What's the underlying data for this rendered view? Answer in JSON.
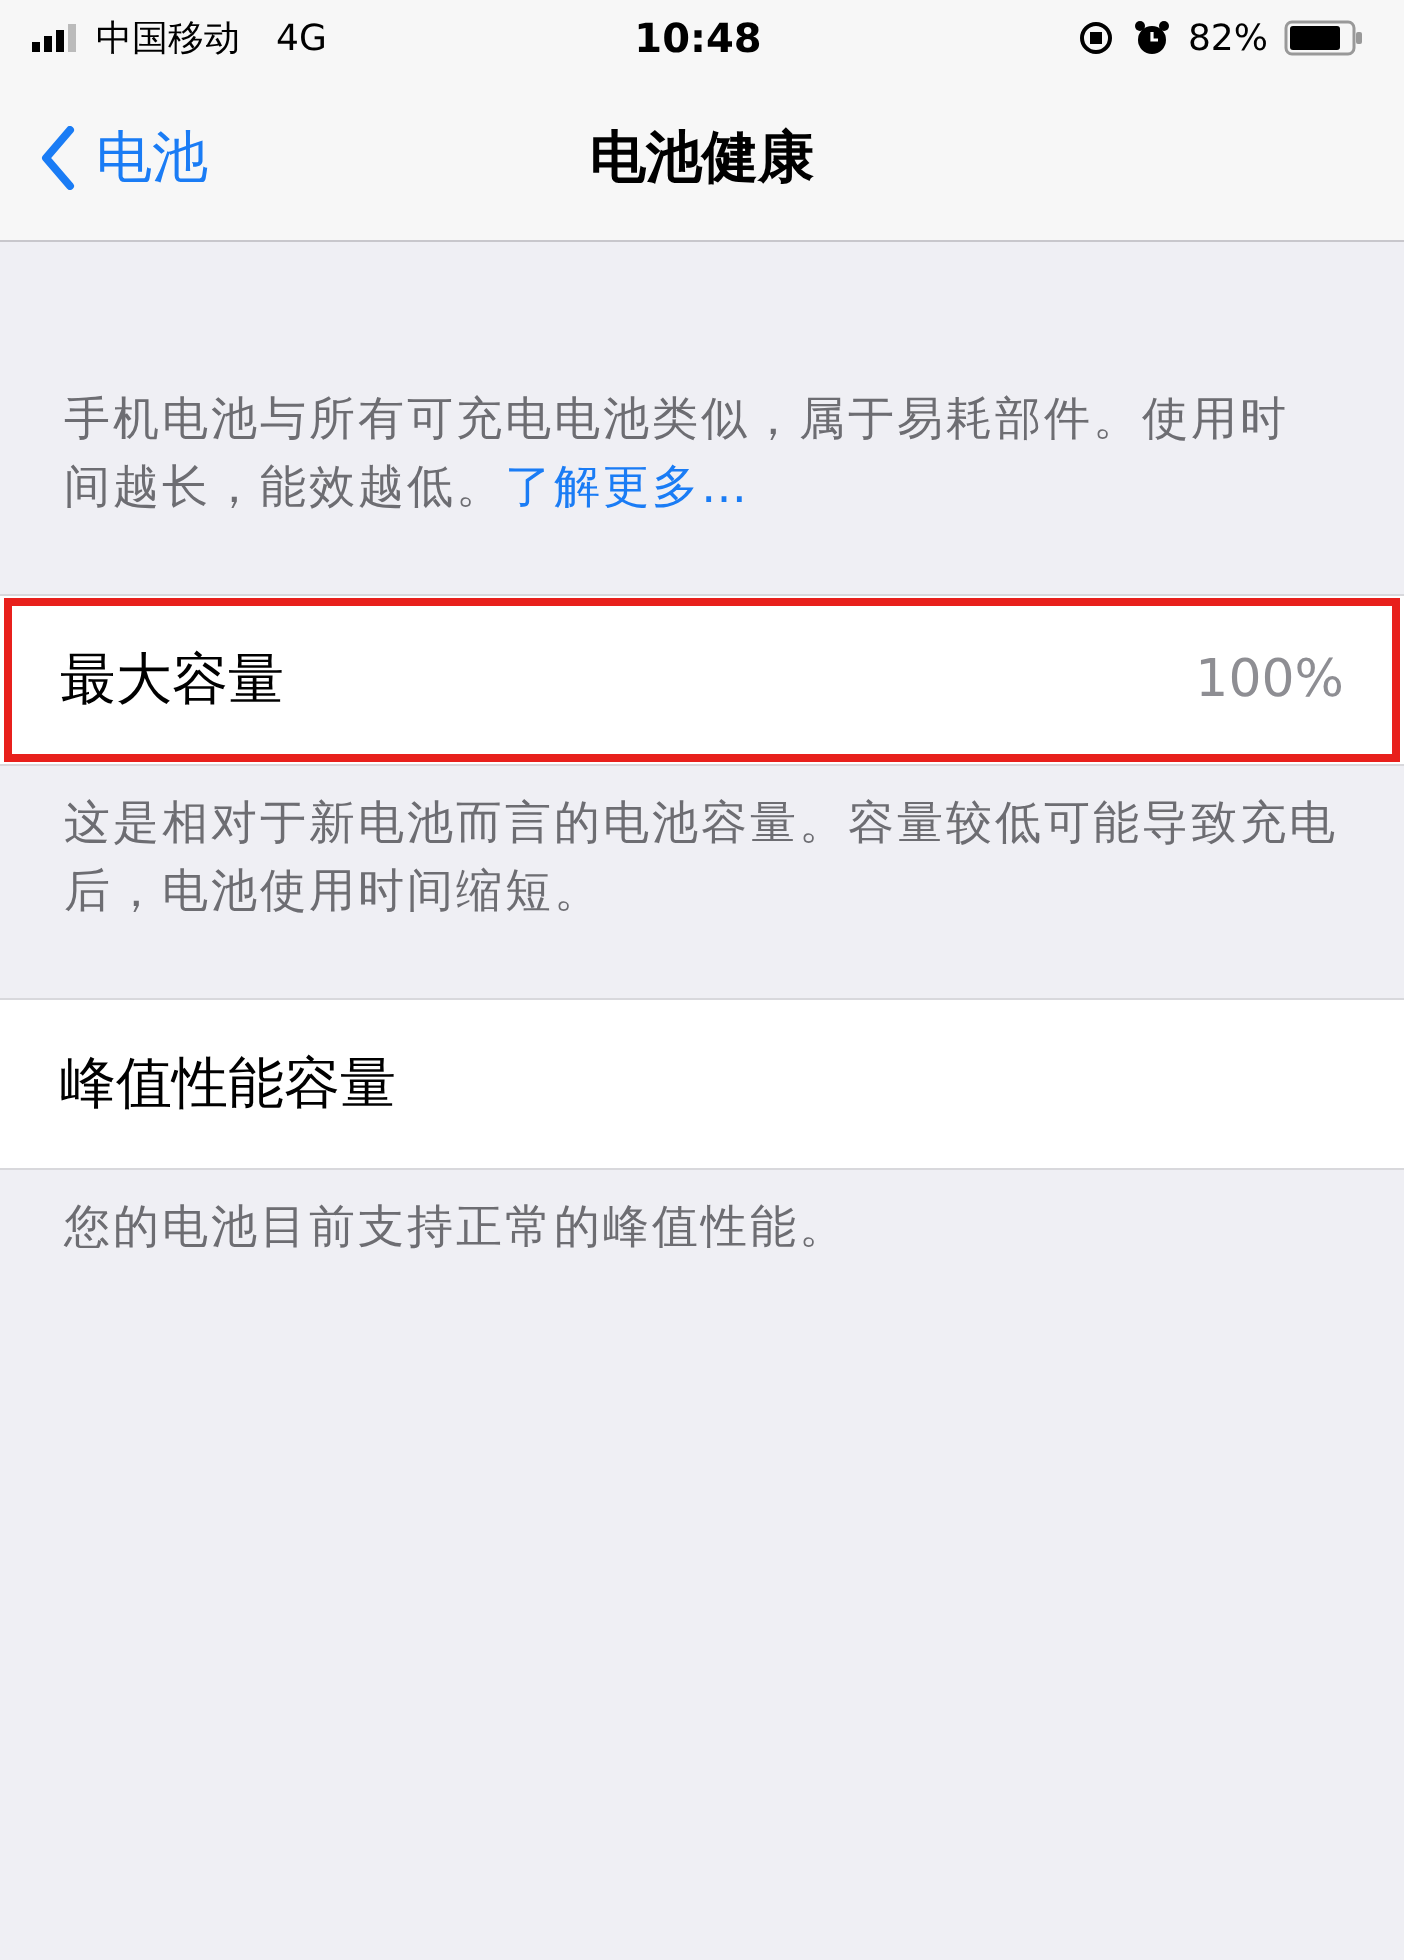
{
  "status_bar": {
    "carrier": "中国移动",
    "network": "4G",
    "time": "10:48",
    "battery_percent": "82%"
  },
  "nav": {
    "back": "电池",
    "title": "电池健康"
  },
  "intro": {
    "text": "手机电池与所有可充电电池类似，属于易耗部件。使用时间越长，能效越低。",
    "link": "了解更多…"
  },
  "rows": [
    {
      "label": "最大容量",
      "value": "100%",
      "highlighted": true,
      "footer": "这是相对于新电池而言的电池容量。容量较低可能导致充电后，电池使用时间缩短。"
    },
    {
      "label": "峰值性能容量",
      "highlighted": false,
      "footer": "您的电池目前支持正常的峰值性能。"
    }
  ]
}
